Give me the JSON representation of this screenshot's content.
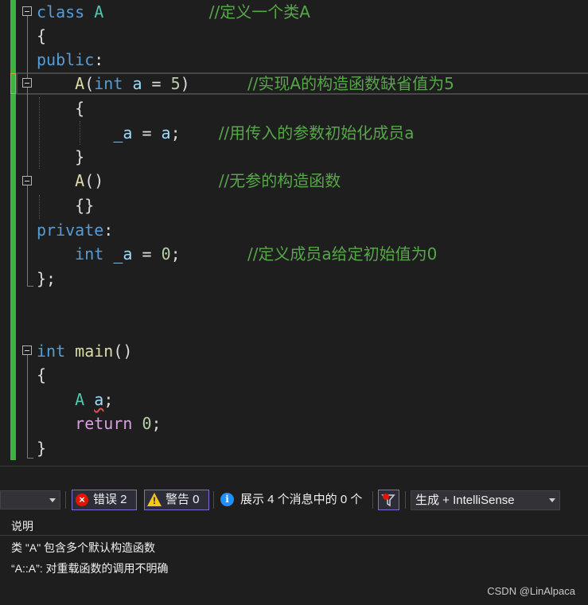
{
  "code": {
    "lines": [
      [
        {
          "t": "class",
          "c": "kw"
        },
        {
          "t": " "
        },
        {
          "t": "A",
          "c": "ty"
        },
        {
          "t": "           "
        },
        {
          "t": "//定义一个类A",
          "c": "cm"
        }
      ],
      [
        {
          "t": "{",
          "c": "pu"
        }
      ],
      [
        {
          "t": "public",
          "c": "kw"
        },
        {
          "t": ":",
          "c": "pu"
        }
      ],
      [
        {
          "t": "    "
        },
        {
          "t": "A",
          "c": "fn"
        },
        {
          "t": "(",
          "c": "pu"
        },
        {
          "t": "int",
          "c": "kw"
        },
        {
          "t": " "
        },
        {
          "t": "a",
          "c": "var"
        },
        {
          "t": " = ",
          "c": "pu"
        },
        {
          "t": "5",
          "c": "num"
        },
        {
          "t": ")",
          "c": "pu"
        },
        {
          "t": "      "
        },
        {
          "t": "//实现A的构造函数缺省值为5",
          "c": "cm"
        }
      ],
      [
        {
          "t": "    "
        },
        {
          "t": "{",
          "c": "pu"
        }
      ],
      [
        {
          "t": "        "
        },
        {
          "t": "_a",
          "c": "var"
        },
        {
          "t": " = ",
          "c": "pu"
        },
        {
          "t": "a",
          "c": "var"
        },
        {
          "t": ";",
          "c": "pu"
        },
        {
          "t": "    "
        },
        {
          "t": "//用传入的参数初始化成员a",
          "c": "cm"
        }
      ],
      [
        {
          "t": "    "
        },
        {
          "t": "}",
          "c": "pu"
        }
      ],
      [
        {
          "t": "    "
        },
        {
          "t": "A",
          "c": "fn"
        },
        {
          "t": "()",
          "c": "pu"
        },
        {
          "t": "            "
        },
        {
          "t": "//无参的构造函数",
          "c": "cm"
        }
      ],
      [
        {
          "t": "    "
        },
        {
          "t": "{}",
          "c": "pu"
        }
      ],
      [
        {
          "t": "private",
          "c": "kw"
        },
        {
          "t": ":",
          "c": "pu"
        }
      ],
      [
        {
          "t": "    "
        },
        {
          "t": "int",
          "c": "kw"
        },
        {
          "t": " "
        },
        {
          "t": "_a",
          "c": "var"
        },
        {
          "t": " = ",
          "c": "pu"
        },
        {
          "t": "0",
          "c": "num"
        },
        {
          "t": ";",
          "c": "pu"
        },
        {
          "t": "       "
        },
        {
          "t": "//定义成员a给定初始值为0",
          "c": "cm"
        }
      ],
      [
        {
          "t": "};",
          "c": "pu"
        }
      ],
      [],
      [],
      [
        {
          "t": "int",
          "c": "kw"
        },
        {
          "t": " "
        },
        {
          "t": "main",
          "c": "fn"
        },
        {
          "t": "()",
          "c": "pu"
        }
      ],
      [
        {
          "t": "{",
          "c": "pu"
        }
      ],
      [
        {
          "t": "    "
        },
        {
          "t": "A",
          "c": "ty"
        },
        {
          "t": " "
        },
        {
          "t": "a",
          "c": "var",
          "sq": true
        },
        {
          "t": ";",
          "c": "pu"
        }
      ],
      [
        {
          "t": "    "
        },
        {
          "t": "return",
          "c": "cf"
        },
        {
          "t": " "
        },
        {
          "t": "0",
          "c": "num"
        },
        {
          "t": ";",
          "c": "pu"
        }
      ],
      [
        {
          "t": "}",
          "c": "pu"
        }
      ]
    ]
  },
  "error_list": {
    "error_button": "错误 2",
    "warning_button": "警告 0",
    "info_text": "展示 4 个消息中的 0 个",
    "build_filter": "生成 + IntelliSense",
    "column_header": "说明",
    "messages": [
      "类 \"A\" 包含多个默认构造函数",
      "“A::A”: 对重载函数的调用不明确"
    ]
  },
  "watermark": "CSDN @LinAlpaca",
  "colors": {
    "background": "#1e1e1e",
    "keyword": "#569cd6",
    "type": "#4ec9b0",
    "function": "#dcdcaa",
    "number": "#b5cea8",
    "comment": "#57a64a",
    "control": "#d8a0df",
    "error": "#e51400",
    "warning": "#f5c518",
    "changed_bar": "#3fb33f"
  }
}
